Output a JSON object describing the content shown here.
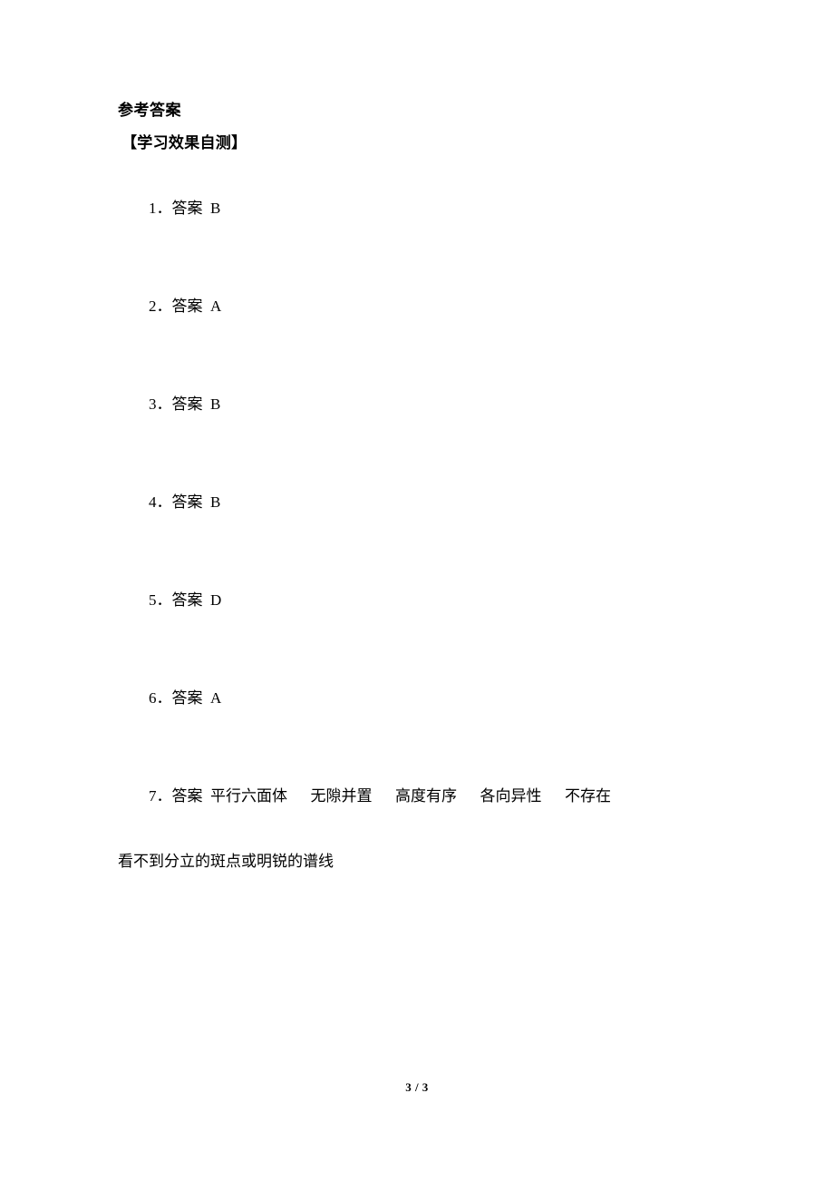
{
  "document": {
    "title": "参考答案",
    "section_heading": "【学习效果自测】"
  },
  "answers": [
    {
      "number": "1．",
      "label": "答案",
      "gap": "  ",
      "value": "B"
    },
    {
      "number": "2．",
      "label": "答案",
      "gap": "  ",
      "value": "A"
    },
    {
      "number": "3．",
      "label": "答案",
      "gap": "  ",
      "value": "B"
    },
    {
      "number": "4．",
      "label": "答案",
      "gap": "  ",
      "value": "B"
    },
    {
      "number": "5．",
      "label": "答案",
      "gap": "  ",
      "value": "D"
    },
    {
      "number": "6．",
      "label": "答案",
      "gap": "  ",
      "value": "A"
    },
    {
      "number": "7．",
      "label": "答案",
      "gap": "  ",
      "value": "平行六面体      无隙并置      高度有序      各向异性      不存在",
      "continuation": "看不到分立的斑点或明锐的谱线"
    }
  ],
  "footer": {
    "page_indicator": "3 / 3"
  }
}
